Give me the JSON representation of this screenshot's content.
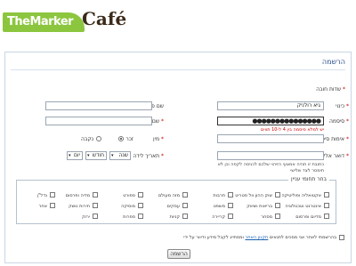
{
  "brand": {
    "name": "TheMarker",
    "cafe": "Café",
    "bar_color": "#8cc63f"
  },
  "page": {
    "title": "הרשמה",
    "required_note": "שדות חובה"
  },
  "form": {
    "nickname": {
      "label": "כינוי",
      "value": "גיא רולניק"
    },
    "first_name": {
      "label": "שם פרטי",
      "value": ""
    },
    "password": {
      "label": "סיסמה",
      "value": "●●●●●●●●●●●●●●●",
      "hint": "יש למלא סיסמה בין 4 ל-10 תווים"
    },
    "last_name": {
      "label": "שם משפחה",
      "value": ""
    },
    "password_confirm": {
      "label": "אימות סיסמה",
      "value": ""
    },
    "gender": {
      "label": "מין",
      "male": "זכר",
      "female": "נקבה",
      "selected": "male"
    },
    "email": {
      "label": "דואר אלקטרוני",
      "value": "",
      "note": "כתובת זו תהיה אמצעי הזיהוי שלכם לכניסה לקפה וכן לא תימסר לצד שלישי"
    },
    "birth_date": {
      "label": "תאריך לידה",
      "year": "שנה",
      "month": "חודש",
      "day": "יום"
    }
  },
  "interests": {
    "legend": "בחר תחומי עניין",
    "columns": [
      [
        "אקטואליה ופוליטיקה",
        "אינטרנט וטכנולוגיה",
        "מדיום ופרסום"
      ],
      [
        "שוק ההון וול סטריט",
        "בריאות ושיווק",
        "מסחר"
      ],
      [
        "תרבות",
        "משפט",
        "קריירה"
      ],
      [
        "מזה מעולם",
        "עסקים",
        "קניות"
      ],
      [
        "ספורט",
        "מוסיקה",
        "ספרות"
      ],
      [
        "מדיה ופרסום",
        "חירות נושק",
        "ירוק"
      ],
      [
        "נדל\"ן",
        "אחר"
      ]
    ]
  },
  "terms": {
    "text_before": "בהרשמתי לאתר אני מסכים לתנאים",
    "link": "תקנון האתר",
    "text_after": "ומסתייג לקבל מידע ודיוור על ידי"
  },
  "submit_label": "הרשמה"
}
